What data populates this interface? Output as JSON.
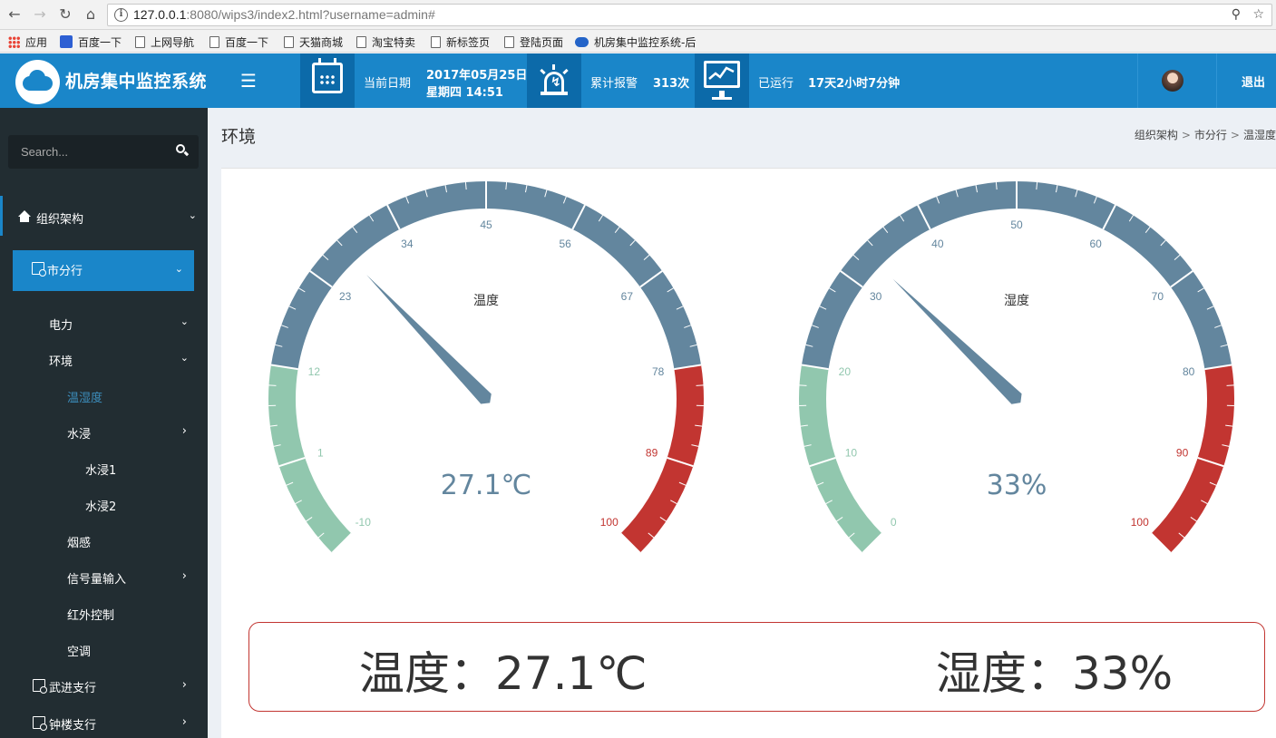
{
  "browser": {
    "url_host": "127.0.0.1",
    "url_rest": ":8080/wips3/index2.html?username=admin#",
    "bookmarks": [
      "应用",
      "百度一下",
      "上网导航",
      "百度一下",
      "天猫商城",
      "淘宝特卖",
      "新标签页",
      "登陆页面",
      "机房集中监控系统-后"
    ]
  },
  "header": {
    "app_title": "机房集中监控系统",
    "date_label": "当前日期",
    "date_value": "2017年05月25日",
    "weekday_time": "星期四 14:51",
    "alarm_label": "累计报警",
    "alarm_value": "313次",
    "uptime_label": "已运行",
    "uptime_value": "17天2小时7分钟",
    "logout": "退出"
  },
  "sidebar": {
    "search_placeholder": "Search...",
    "items": [
      {
        "label": "组织架构"
      },
      {
        "label": "市分行"
      },
      {
        "label": "电力"
      },
      {
        "label": "环境"
      },
      {
        "label": "温湿度"
      },
      {
        "label": "水浸"
      },
      {
        "label": "水浸1"
      },
      {
        "label": "水浸2"
      },
      {
        "label": "烟感"
      },
      {
        "label": "信号量输入"
      },
      {
        "label": "红外控制"
      },
      {
        "label": "空调"
      },
      {
        "label": "武进支行"
      },
      {
        "label": "钟楼支行"
      }
    ]
  },
  "content": {
    "page_title": "环境",
    "breadcrumb": [
      "组织架构",
      "市分行",
      "温湿度"
    ],
    "readout_temp": "温度：27.1℃",
    "readout_humi": "湿度：33%"
  },
  "colors": {
    "header_blue": "#1a86c9",
    "header_dark": "#0c6aa9",
    "sidebar_bg": "#222d32",
    "gauge_green": "#91c7ae",
    "gauge_blue": "#63869e",
    "gauge_red": "#c23531"
  },
  "gauges": [
    {
      "name": "温度",
      "value": 27.1,
      "display": "27.1℃",
      "min": -10,
      "max": 100,
      "ticks": [
        "-10",
        "1",
        "12",
        "23",
        "34",
        "45",
        "56",
        "67",
        "78",
        "89",
        "100"
      ],
      "bands": [
        [
          0.2,
          "#91c7ae"
        ],
        [
          0.8,
          "#63869e"
        ],
        [
          1.0,
          "#c23531"
        ]
      ]
    },
    {
      "name": "湿度",
      "value": 33,
      "display": "33%",
      "min": 0,
      "max": 100,
      "ticks": [
        "0",
        "10",
        "20",
        "30",
        "40",
        "50",
        "60",
        "70",
        "80",
        "90",
        "100"
      ],
      "bands": [
        [
          0.2,
          "#91c7ae"
        ],
        [
          0.8,
          "#63869e"
        ],
        [
          1.0,
          "#c23531"
        ]
      ]
    }
  ]
}
